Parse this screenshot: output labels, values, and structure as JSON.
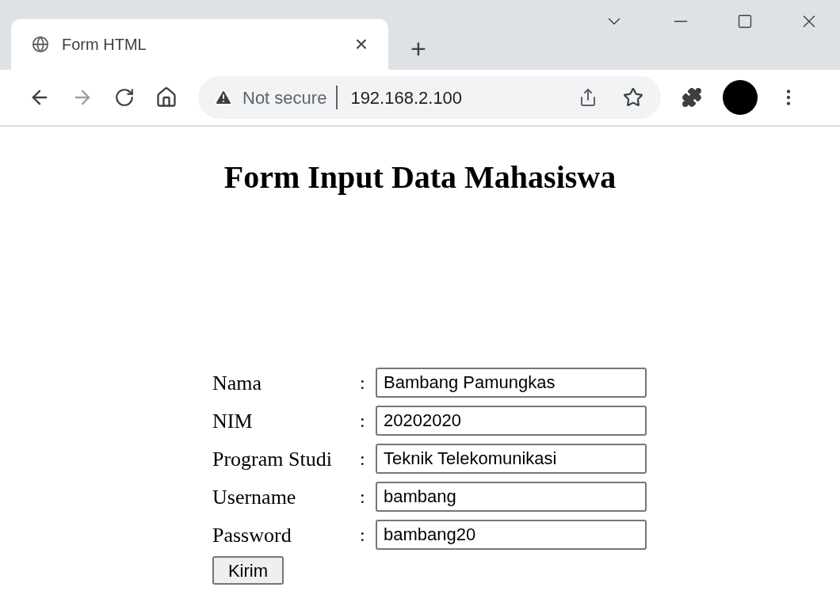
{
  "browser": {
    "tab": {
      "title": "Form HTML",
      "close": "×"
    },
    "new_tab": "+",
    "security": "Not secure",
    "url": "192.168.2.100"
  },
  "page": {
    "heading": "Form Input Data Mahasiswa",
    "fields": [
      {
        "label": "Nama",
        "separator": ":",
        "value": "Bambang Pamungkas"
      },
      {
        "label": "NIM",
        "separator": ":",
        "value": "20202020"
      },
      {
        "label": "Program Studi",
        "separator": ":",
        "value": "Teknik Telekomunikasi"
      },
      {
        "label": "Username",
        "separator": ":",
        "value": "bambang"
      },
      {
        "label": "Password",
        "separator": ":",
        "value": "bambang20"
      }
    ],
    "submit": "Kirim"
  }
}
